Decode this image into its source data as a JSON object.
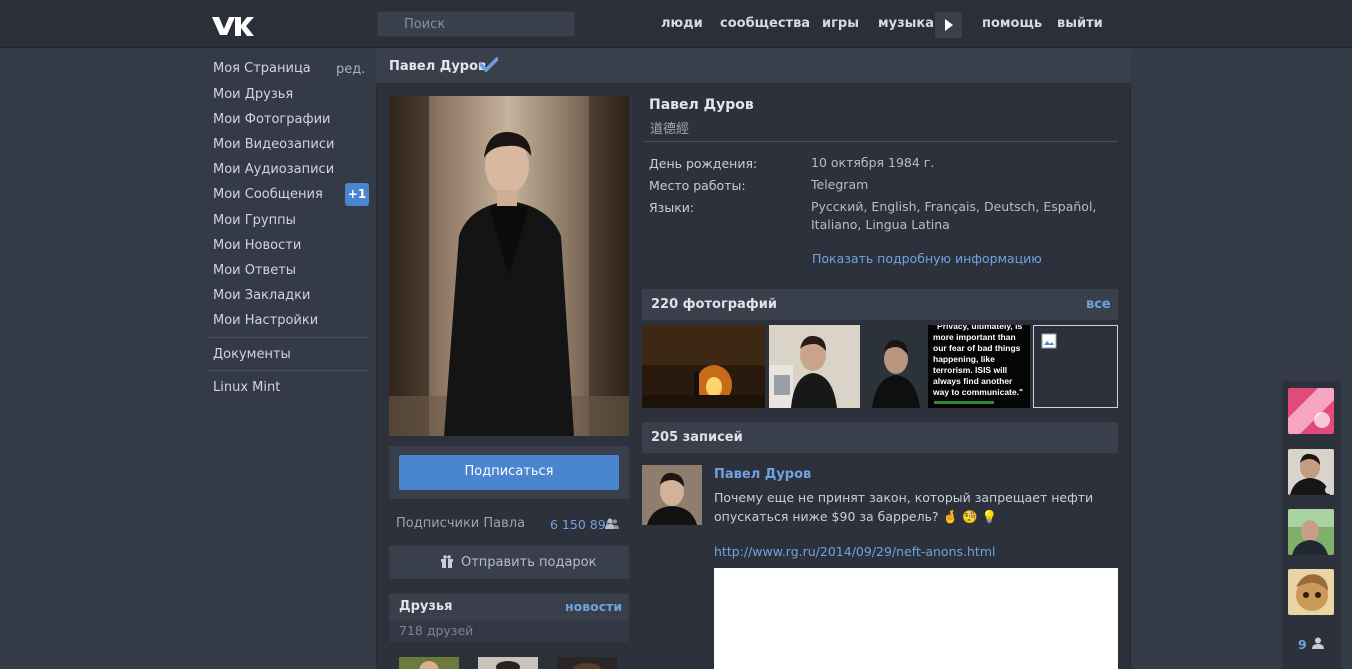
{
  "header": {
    "search_placeholder": "Поиск",
    "nav": [
      "люди",
      "сообщества",
      "игры",
      "музыка",
      "помощь",
      "выйти"
    ]
  },
  "left_menu": {
    "items": [
      "Моя Страница",
      "Мои Друзья",
      "Мои Фотографии",
      "Мои Видеозаписи",
      "Мои Аудиозаписи",
      "Мои Сообщения",
      "Мои Группы",
      "Мои Новости",
      "Мои Ответы",
      "Мои Закладки",
      "Мои Настройки"
    ],
    "edit_label": "ред.",
    "messages_badge": "+1",
    "documents": "Документы",
    "linux_mint": "Linux Mint"
  },
  "profile": {
    "page_name": "Павел Дуров",
    "name": "Павел Дуров",
    "status": "道德經",
    "subscribe_button": "Подписаться",
    "subscribers_label": "Подписчики Павла",
    "subscribers_count": "6 150 890",
    "gift_button": "Отправить подарок",
    "info": [
      {
        "label": "День рождения:",
        "value": "10 октября 1984 г."
      },
      {
        "label": "Место работы:",
        "value": "Telegram"
      },
      {
        "label": "Языки:",
        "value": "Русский, English, Français, Deutsch, Español, Italiano, Lingua Latina"
      }
    ],
    "show_more": "Показать подробную информацию"
  },
  "friends": {
    "title": "Друзья",
    "news_link": "новости",
    "count": "718 друзей"
  },
  "photos": {
    "title": "220 фотографий",
    "all_link": "все",
    "quote_text": "\"Privacy, ultimately, is more important than our fear of bad things happening, like terrorism. ISIS will always find another way to communicate.\""
  },
  "wall": {
    "title": "205 записей",
    "post": {
      "author": "Павел Дуров",
      "text": "Почему еще не принят закон, который запрещает нефти опускаться ниже $90 за баррель? 🤞 🧐 💡",
      "link": "http://www.rg.ru/2014/09/29/neft-anons.html"
    }
  },
  "chat": {
    "online_count": "9"
  },
  "colors": {
    "background": "#353a47",
    "panel": "#2d313c",
    "accent": "#4a86d0",
    "link": "#6fa2e0"
  }
}
